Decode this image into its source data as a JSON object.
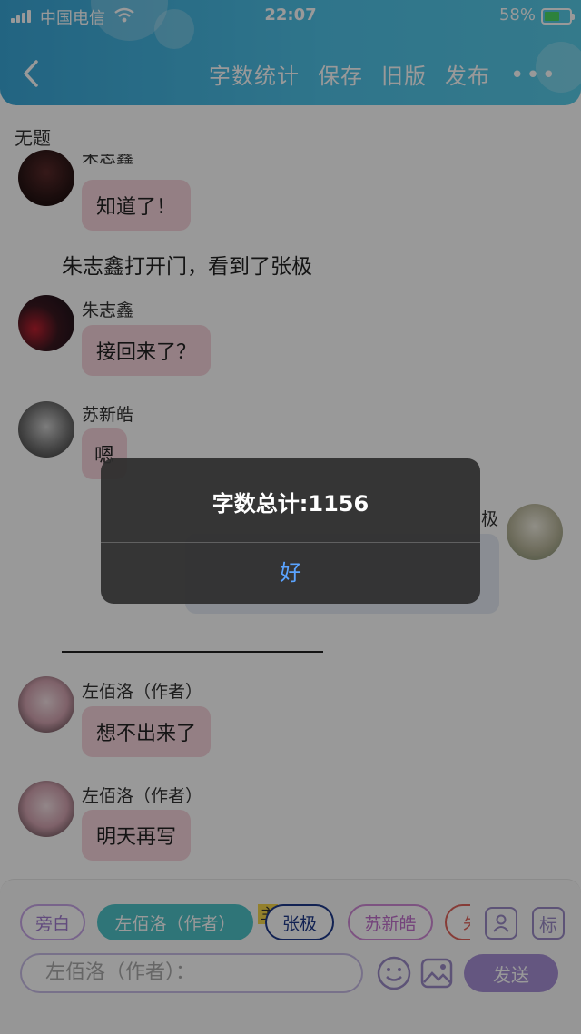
{
  "status_bar": {
    "carrier": "中国电信",
    "time": "22:07",
    "battery": "58%"
  },
  "header": {
    "actions": [
      "字数统计",
      "保存",
      "旧版",
      "发布"
    ]
  },
  "document": {
    "title": "无题"
  },
  "chat": {
    "msg1_name_partial": "朱志鑫",
    "msg1_text": "知道了！",
    "narration1": "朱志鑫打开门，看到了张极",
    "msg2_name": "朱志鑫",
    "msg2_text": "接回来了？",
    "msg3_name": "苏新皓",
    "msg3_text": "嗯",
    "msg4_name_partial": "极",
    "msg5_name": "左佰洛（作者）",
    "msg5_text": "想不出来了",
    "msg6_name": "左佰洛（作者）",
    "msg6_text": "明天再写"
  },
  "toolbar": {
    "chips": [
      "旁白",
      "左佰洛（作者）",
      "张极",
      "苏新皓",
      "朱"
    ],
    "tag_main": "主",
    "icon_btn_label": "标",
    "input_placeholder": "左佰洛（作者）：",
    "send_label": "发送"
  },
  "alert": {
    "title": "字数总计:1156",
    "ok_label": "好"
  },
  "colors": {
    "header": "#4fc3e8",
    "bubble": "#f7d4dc",
    "accent": "#a78fd6",
    "alert_link": "#5aa3ff"
  }
}
